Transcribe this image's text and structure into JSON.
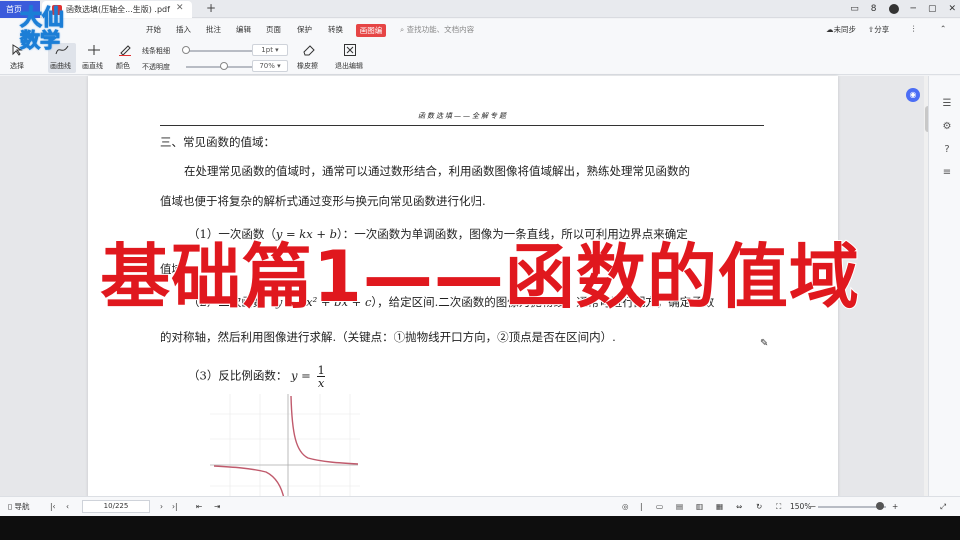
{
  "tabs": {
    "home_label": "首页",
    "doc_title": "函数选填(压轴全...生版) .pdf",
    "close_glyph": "✕",
    "add_glyph": "+"
  },
  "window_controls": {
    "badge": "8",
    "min": "─",
    "max": "▢",
    "close": "✕"
  },
  "menu": {
    "items": [
      "开始",
      "插入",
      "批注",
      "编辑",
      "页面",
      "保护",
      "转换"
    ],
    "active": "画图编",
    "search_placeholder": "查找功能、文档内容",
    "sync": "未同步",
    "share": "分享"
  },
  "toolbar": {
    "select": "选择",
    "free_curve": "画曲线",
    "straight_line": "画直线",
    "color": "颜色",
    "line_thickness": "线条粗细",
    "thickness_value": "1pt",
    "opacity": "不透明度",
    "opacity_value": "70%",
    "eraser": "橡皮擦",
    "exit_edit": "退出编辑",
    "accent_color": "#e03131"
  },
  "logo": {
    "line1": "大仙",
    "line2": "数学"
  },
  "document": {
    "header": "函数选填——全解专题",
    "heading": "三、常见函数的值域：",
    "para1_line1": "在处理常见函数的值域时，通常可以通过数形结合，利用函数图像将值域解出，熟练处理常见函数的",
    "para1_line2": "值域也便于将复杂的解析式通过变形与换元向常见函数进行化归.",
    "item1_prefix": "（1）一次函数（",
    "item1_formula": "y = kx + b",
    "item1_suffix": "）：一次函数为单调函数，图像为一条直线，所以可利用边界点来确定",
    "item1_line2": "值域.",
    "item2_prefix": "（2）二次函数（",
    "item2_formula": "y = ax² + bx + c",
    "item2_suffix": "），给定区间.二次函数的图像为抛物线，通常可进行配方，确定函数",
    "item2_line2": "的对称轴，然后利用图像进行求解.（关键点：①抛物线开口方向，②顶点是否在区间内）.",
    "item3_prefix": "（3）反比例函数：",
    "item3_formula_lhs": "y =",
    "item3_numerator": "1",
    "item3_denominator": "x"
  },
  "overlay_title": "基础篇1——函数的值域",
  "overlay_color": "#e0181e",
  "status": {
    "nav": "导航",
    "page_indicator": "10/225",
    "zoom": "150%"
  }
}
